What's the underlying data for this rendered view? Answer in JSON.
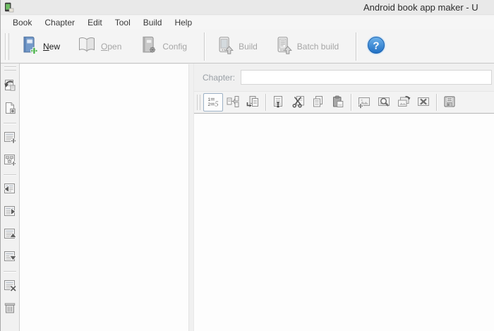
{
  "window": {
    "title": "Android book app maker - U",
    "icon": "app-icon"
  },
  "menubar": {
    "items": [
      {
        "label": "Book"
      },
      {
        "label": "Chapter"
      },
      {
        "label": "Edit"
      },
      {
        "label": "Tool"
      },
      {
        "label": "Build"
      },
      {
        "label": "Help"
      }
    ]
  },
  "main_toolbar": {
    "buttons": [
      {
        "label": "New",
        "mnemonic": "N",
        "icon": "new-book-icon",
        "enabled": true
      },
      {
        "label": "Open",
        "mnemonic": "O",
        "icon": "open-book-icon",
        "enabled": false
      },
      {
        "label": "Config",
        "mnemonic": "g",
        "icon": "config-book-icon",
        "enabled": false
      },
      {
        "label": "Build",
        "icon": "build-phone-icon",
        "enabled": false
      },
      {
        "label": "Batch build",
        "icon": "batch-build-phone-icon",
        "enabled": false
      }
    ],
    "help_icon": "help-circle-icon",
    "help_glyph": "?"
  },
  "left_rail": {
    "icons": [
      "import-chapter-icon",
      "add-file-icon",
      "add-chapter-icon",
      "add-subchapter-icon",
      "move-chapter-left-icon",
      "move-chapter-right-icon",
      "move-chapter-up-icon",
      "move-chapter-down-icon",
      "delete-chapter-icon",
      "clear-chapters-icon"
    ]
  },
  "chapter_bar": {
    "label": "Chapter:",
    "value": ""
  },
  "editor_toolbar": {
    "icons": [
      "chapter-numbering-icon",
      "split-chapter-icon",
      "merge-chapters-icon",
      "insert-text-icon",
      "cut-icon",
      "copy-icon",
      "paste-icon",
      "insert-image-icon",
      "preview-image-icon",
      "replace-image-icon",
      "delete-image-icon",
      "save-icon"
    ]
  },
  "colors": {
    "new_book_blue": "#7399c9",
    "plus_green": "#4db24c",
    "help_blue": "#2f7fd4",
    "disabled_text": "#a6a6a6",
    "titlebar_bg": "#e9e9e9",
    "toolbar_bg": "#f4f4f4"
  }
}
